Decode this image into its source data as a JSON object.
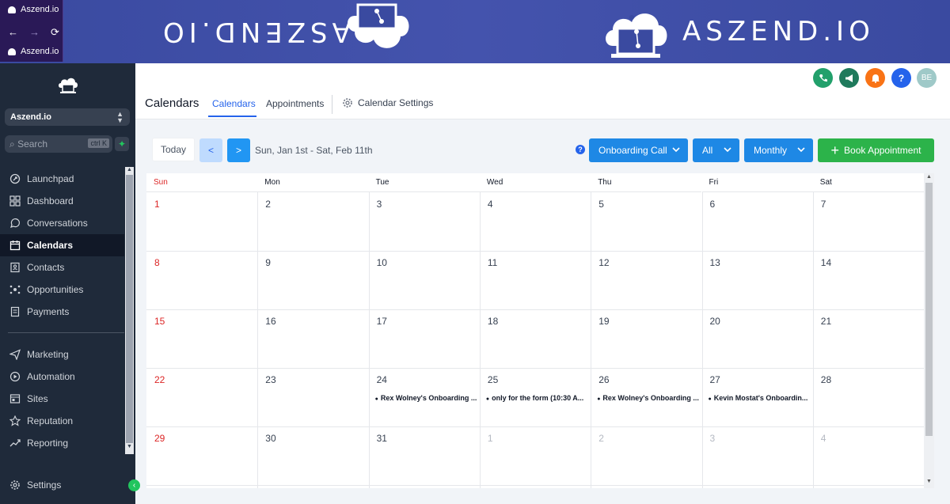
{
  "browser": {
    "tab_title": "Aszend.io",
    "tab_title_2": "Aszend.io"
  },
  "banner": {
    "brand": "ASZEND.IO",
    "mirrored_brand": "ASZEND.IO"
  },
  "sidebar": {
    "account": "Aszend.io",
    "search_placeholder": "Search",
    "search_shortcut": "ctrl K",
    "items": [
      {
        "label": "Launchpad",
        "icon": "rocket-icon"
      },
      {
        "label": "Dashboard",
        "icon": "dashboard-icon"
      },
      {
        "label": "Conversations",
        "icon": "chat-icon"
      },
      {
        "label": "Calendars",
        "icon": "calendar-icon",
        "active": true
      },
      {
        "label": "Contacts",
        "icon": "contacts-icon"
      },
      {
        "label": "Opportunities",
        "icon": "opportunities-icon"
      },
      {
        "label": "Payments",
        "icon": "payments-icon"
      },
      {
        "label": "Marketing",
        "icon": "send-icon"
      },
      {
        "label": "Automation",
        "icon": "automation-icon"
      },
      {
        "label": "Sites",
        "icon": "sites-icon"
      },
      {
        "label": "Reputation",
        "icon": "star-icon"
      },
      {
        "label": "Reporting",
        "icon": "chart-icon"
      }
    ],
    "settings": "Settings"
  },
  "header": {
    "page_title": "Calendars",
    "tabs": [
      "Calendars",
      "Appointments",
      "Calendar Settings"
    ],
    "avatar_initials": "BE",
    "colors": {
      "phone": "#22a06b",
      "megaphone": "#1f7a5c",
      "bell": "#f97316",
      "help": "#2563eb",
      "avatar": "#9fc9c8"
    }
  },
  "toolbar": {
    "today": "Today",
    "prev": "<",
    "next": ">",
    "range": "Sun, Jan 1st - Sat, Feb 11th",
    "help": "?",
    "calendar_filter": "Onboarding Call",
    "user_filter": "All",
    "view": "Monthly",
    "book": "Book Appointment"
  },
  "calendar": {
    "weekdays": [
      "Sun",
      "Mon",
      "Tue",
      "Wed",
      "Thu",
      "Fri",
      "Sat"
    ],
    "weeks": [
      [
        "1",
        "2",
        "3",
        "4",
        "5",
        "6",
        "7"
      ],
      [
        "8",
        "9",
        "10",
        "11",
        "12",
        "13",
        "14"
      ],
      [
        "15",
        "16",
        "17",
        "18",
        "19",
        "20",
        "21"
      ],
      [
        "22",
        "23",
        "24",
        "25",
        "26",
        "27",
        "28"
      ],
      [
        "29",
        "30",
        "31",
        "1",
        "2",
        "3",
        "4"
      ]
    ],
    "events": {
      "tue24": "Rex Wolney's Onboarding ...",
      "wed25": "only for the form (10:30 A...",
      "thu26": "Rex Wolney's Onboarding ...",
      "fri27": "Kevin Mostat's Onboardin..."
    }
  }
}
